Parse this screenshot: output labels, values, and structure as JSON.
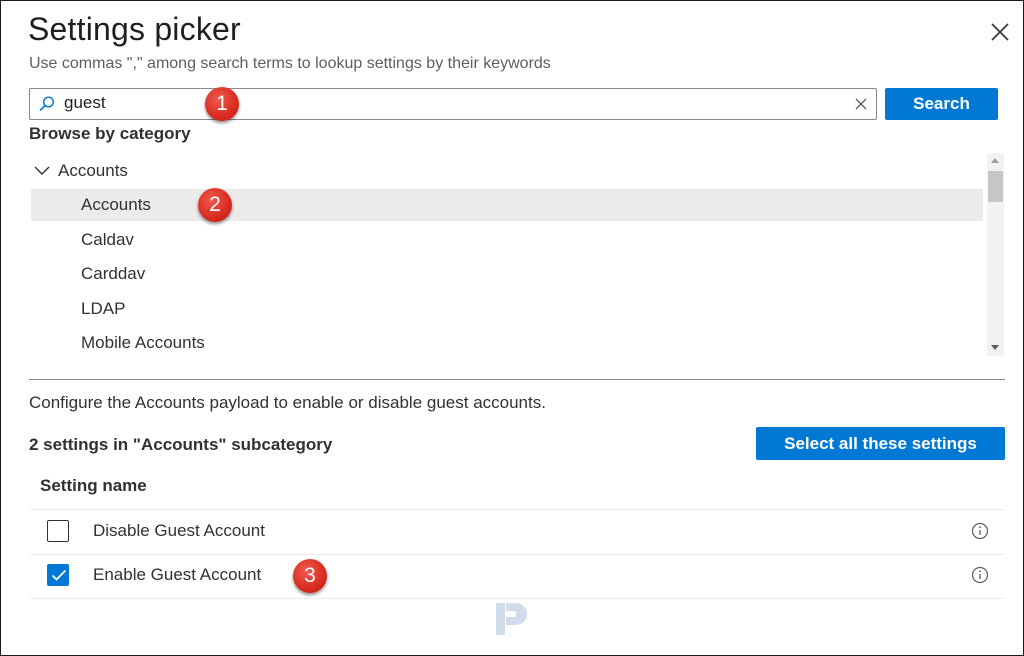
{
  "dialog": {
    "title": "Settings picker",
    "subtitle": "Use commas \",\" among search terms to lookup settings by their keywords",
    "close_icon": "close-icon"
  },
  "search": {
    "value": "guest",
    "placeholder": "",
    "button_label": "Search",
    "icon": "search-icon",
    "clear_icon": "clear-icon"
  },
  "browse": {
    "label": "Browse by category",
    "parent": {
      "label": "Accounts",
      "expanded": true
    },
    "items": [
      {
        "label": "Accounts",
        "selected": true
      },
      {
        "label": "Caldav",
        "selected": false
      },
      {
        "label": "Carddav",
        "selected": false
      },
      {
        "label": "LDAP",
        "selected": false
      },
      {
        "label": "Mobile Accounts",
        "selected": false
      }
    ]
  },
  "details": {
    "description": "Configure the Accounts payload to enable or disable guest accounts.",
    "count_label": "2 settings in \"Accounts\" subcategory",
    "select_all_label": "Select all these settings",
    "column_header": "Setting name",
    "settings": [
      {
        "name": "Disable Guest Account",
        "checked": false
      },
      {
        "name": "Enable Guest Account",
        "checked": true
      }
    ]
  },
  "annotations": {
    "badge1": "1",
    "badge2": "2",
    "badge3": "3"
  },
  "colors": {
    "accent": "#0078d4",
    "badge": "#d92b1f"
  }
}
